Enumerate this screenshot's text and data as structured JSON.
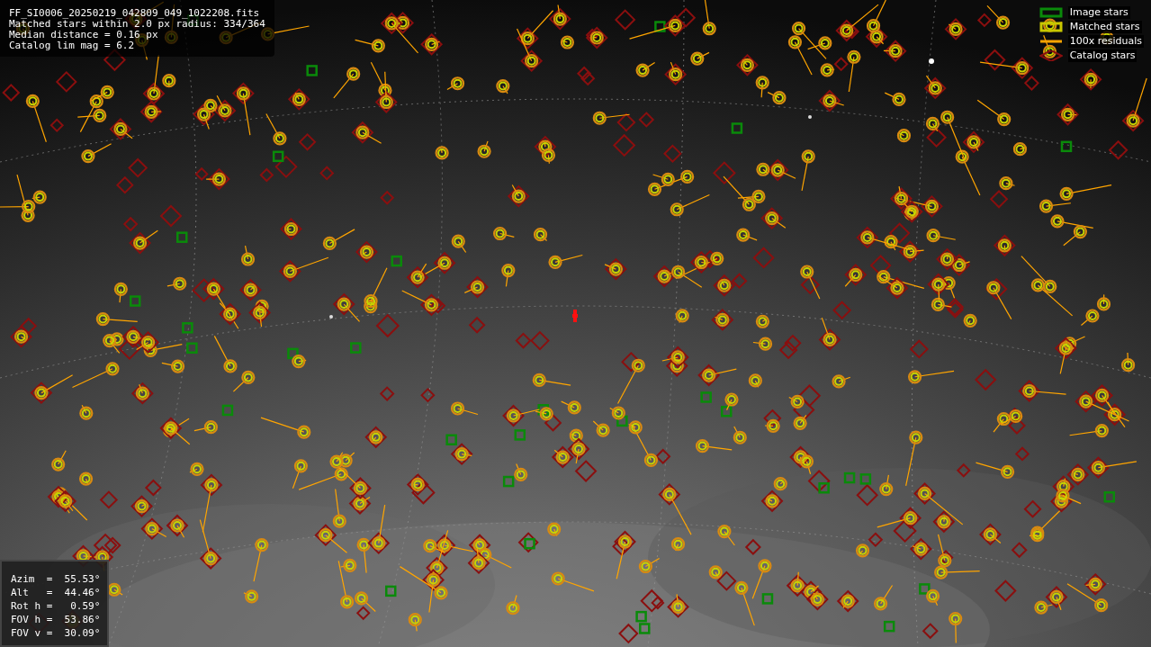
{
  "info": {
    "lines": [
      "FF_SI0006_20250219_042809_049_1022208.fits",
      "Matched stars within 2.0 px radius: 334/364",
      "Median distance = 0.16 px",
      "Catalog lim mag = 6.2"
    ]
  },
  "legend": [
    {
      "kind": "rect",
      "color": "#0a8a0a",
      "label": "Image stars"
    },
    {
      "kind": "rect",
      "color": "#c8c800",
      "label": "Matched stars"
    },
    {
      "kind": "line",
      "color": "#ffa500",
      "label": "100x residuals"
    },
    {
      "kind": "diamond",
      "color": "#8a0f0f",
      "label": "Catalog stars"
    }
  ],
  "pointing": {
    "lines": [
      "Azim  =  55.53°",
      "Alt   =  44.46°",
      "Rot h =   0.59°",
      "FOV h =  53.86°",
      "FOV v =  30.09°"
    ]
  }
}
